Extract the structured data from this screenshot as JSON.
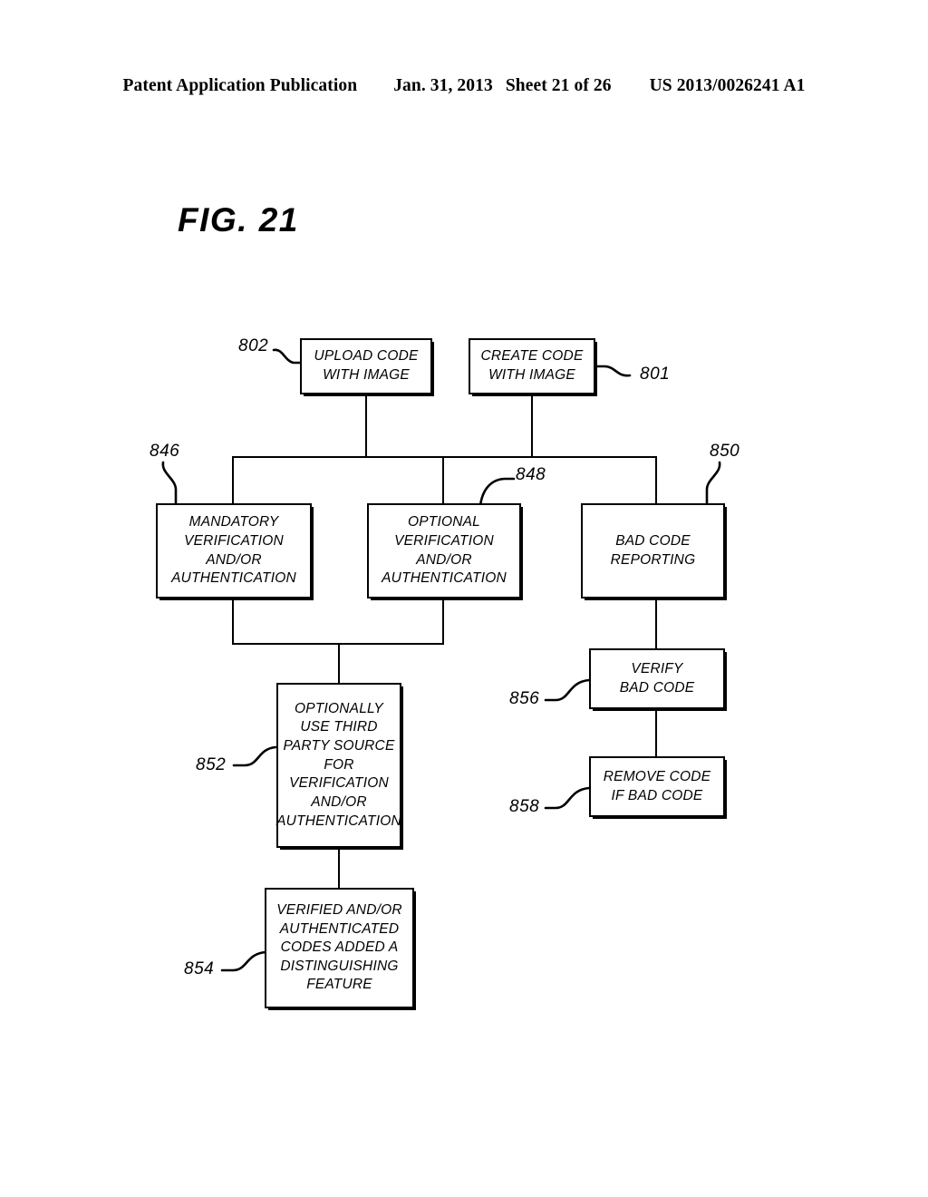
{
  "header": {
    "publication": "Patent Application Publication",
    "date": "Jan. 31, 2013",
    "sheet": "Sheet 21 of 26",
    "number": "US 2013/0026241 A1"
  },
  "figure": {
    "title": "FIG. 21"
  },
  "diagram": {
    "nodes": [
      {
        "id": "n802",
        "ref": "802",
        "text": "UPLOAD CODE\nWITH IMAGE"
      },
      {
        "id": "n801",
        "ref": "801",
        "text": "CREATE CODE\nWITH IMAGE"
      },
      {
        "id": "n846",
        "ref": "846",
        "text": "MANDATORY\nVERIFICATION\nAND/OR\nAUTHENTICATION"
      },
      {
        "id": "n848",
        "ref": "848",
        "text": "OPTIONAL\nVERIFICATION\nAND/OR\nAUTHENTICATION"
      },
      {
        "id": "n850",
        "ref": "850",
        "text": "BAD CODE\nREPORTING"
      },
      {
        "id": "n852",
        "ref": "852",
        "text": "OPTIONALLY\nUSE THIRD\nPARTY SOURCE\nFOR\nVERIFICATION\nAND/OR\nAUTHENTICATION"
      },
      {
        "id": "n854",
        "ref": "854",
        "text": "VERIFIED AND/OR\nAUTHENTICATED\nCODES ADDED A\nDISTINGUISHING\nFEATURE"
      },
      {
        "id": "n856",
        "ref": "856",
        "text": "VERIFY\nBAD CODE"
      },
      {
        "id": "n858",
        "ref": "858",
        "text": "REMOVE CODE\nIF BAD CODE"
      }
    ]
  },
  "colors": {
    "ink": "#000000",
    "paper": "#ffffff"
  }
}
